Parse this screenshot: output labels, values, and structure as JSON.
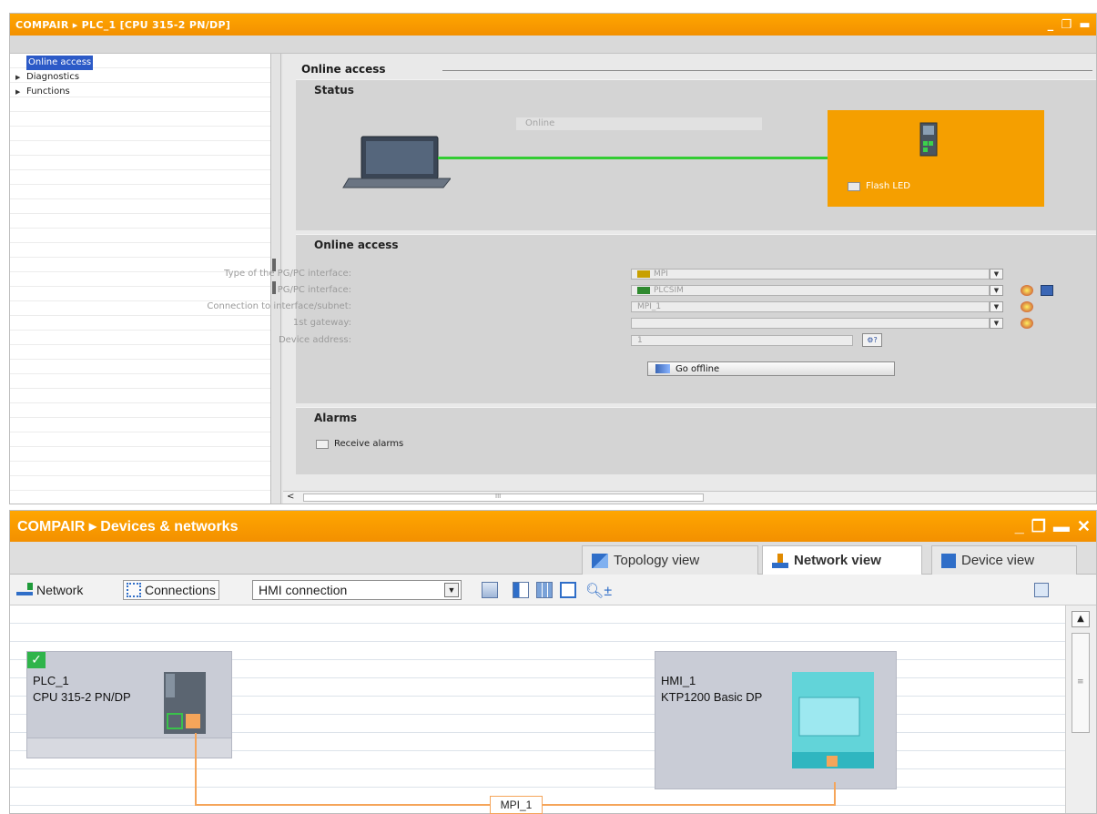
{
  "top_window": {
    "breadcrumb": "COMPAIR ▸ PLC_1 [CPU 315-2 PN/DP]",
    "window_controls": [
      "_",
      "❐",
      "▬"
    ],
    "nav": [
      {
        "label": "Online access",
        "selected": true
      },
      {
        "label": "Diagnostics",
        "selected": false
      },
      {
        "label": "Functions",
        "selected": false
      }
    ],
    "main_heading": "Online access",
    "status": {
      "title": "Status",
      "state_text": "Online",
      "flash_led_label": "Flash LED",
      "link_color": "#33cc33",
      "device_bg": "#f59f00"
    },
    "online_access": {
      "title": "Online access",
      "fields": [
        {
          "label": "Type of the PG/PC interface:",
          "value": "MPI",
          "icon": "mpi-icon",
          "has_dropdown": true
        },
        {
          "label": "PG/PC interface:",
          "value": "PLCSIM",
          "icon": "plcsim-icon",
          "has_dropdown": true
        },
        {
          "label": "Connection to interface/subnet:",
          "value": "MPI_1",
          "icon": "",
          "has_dropdown": true
        },
        {
          "label": "1st gateway:",
          "value": "",
          "icon": "",
          "has_dropdown": true
        },
        {
          "label": "Device address:",
          "value": "1",
          "icon": "",
          "has_dropdown": false
        }
      ],
      "go_offline_label": "Go offline"
    },
    "alarms": {
      "title": "Alarms",
      "receive_label": "Receive alarms"
    },
    "scroll_left": "<",
    "scroll_grip": "III"
  },
  "bottom_window": {
    "breadcrumb": "COMPAIR ▸ Devices & networks",
    "window_controls": [
      "_",
      "❐",
      "▬",
      "✕"
    ],
    "tabs": [
      {
        "label": "Topology view",
        "icon": "topology-icon",
        "active": false
      },
      {
        "label": "Network view",
        "icon": "network-view-icon",
        "active": true
      },
      {
        "label": "Device view",
        "icon": "device-view-icon",
        "active": false
      }
    ],
    "toolbar": {
      "network_label": "Network",
      "connections_label": "Connections",
      "connection_type": "HMI connection"
    },
    "devices": [
      {
        "name": "PLC_1",
        "type": "CPU 315-2 PN/DP",
        "checked": true
      },
      {
        "name": "HMI_1",
        "type": "KTP1200 Basic DP",
        "checked": false
      }
    ],
    "subnet_label": "MPI_1",
    "subnet_color": "#f5a55a"
  }
}
